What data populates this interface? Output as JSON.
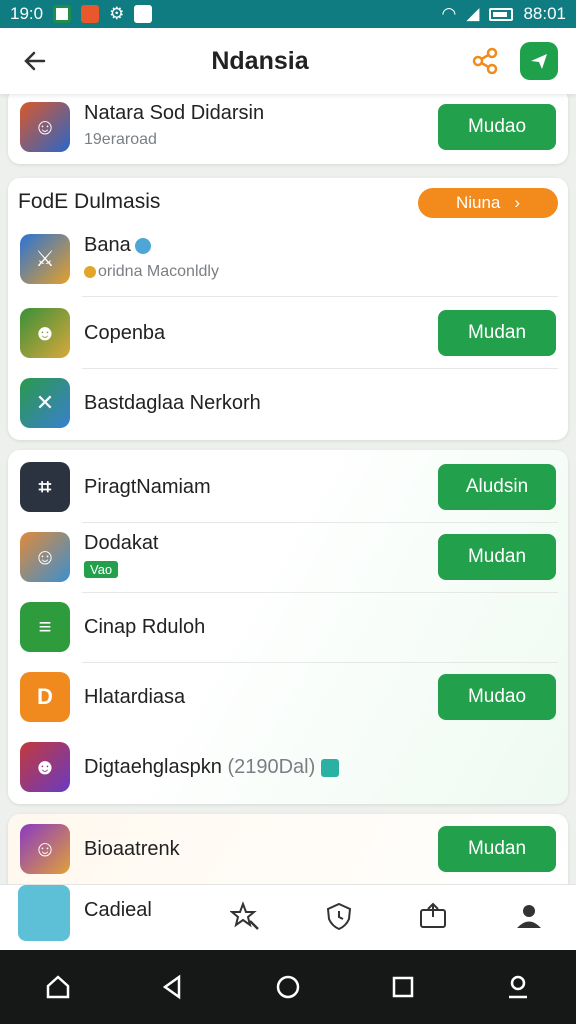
{
  "status_bar": {
    "time": "19:0",
    "right_time": "88:01"
  },
  "header": {
    "title": "Ndansia"
  },
  "top_item": {
    "name": "Natara Sod Didarsin",
    "sub": "19eraroad",
    "button": "Mudao"
  },
  "section1": {
    "title": "FodE Dulmasis",
    "pill_label": "Niuna",
    "pill_chevron": "›",
    "items": [
      {
        "name": "Bana",
        "sub": "oridna Maconldly"
      },
      {
        "name": "Copenba",
        "button": "Mudan"
      },
      {
        "name": "Bastdaglaa Nerkorh"
      }
    ]
  },
  "section2": {
    "items": [
      {
        "name": "PiragtNamiam",
        "button": "Aludsin"
      },
      {
        "name": "Dodakat",
        "badge": "Vao",
        "button": "Mudan"
      },
      {
        "name": "Cinap Rduloh"
      },
      {
        "name": "Hlatardiasa",
        "button": "Mudao"
      },
      {
        "name": "Digtaehglaspkn",
        "sub": "(2190Dal)"
      }
    ]
  },
  "section3": {
    "items": [
      {
        "name": "Bioaatrenk",
        "button": "Mudan"
      }
    ]
  },
  "bottom_nav": {
    "app_label": "Cadieal"
  },
  "colors": {
    "accent_green": "#23a04c",
    "status_teal": "#0f7c82",
    "orange": "#f28a1c"
  }
}
